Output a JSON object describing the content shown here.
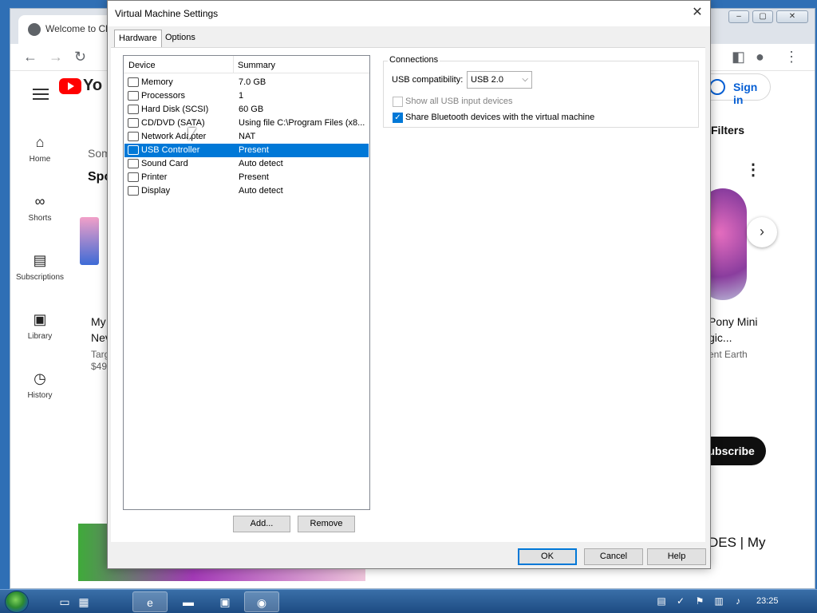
{
  "browser": {
    "tab_title": "Welcome to Cl",
    "window_controls": [
      "–",
      "▢",
      "✕"
    ]
  },
  "youtube": {
    "logo_text": "Yo",
    "sign_in": "Sign in",
    "filters": "Filters",
    "subscribe": "Subscribe",
    "side_items": [
      {
        "label": "Home",
        "icon": "home-icon"
      },
      {
        "label": "Shorts",
        "icon": "shorts-icon"
      },
      {
        "label": "Subscriptions",
        "icon": "subscriptions-icon"
      },
      {
        "label": "Library",
        "icon": "library-icon"
      },
      {
        "label": "History",
        "icon": "history-icon"
      }
    ],
    "fragments": {
      "som": "Som",
      "spo": "Spo",
      "my": "My",
      "nev": "Nev",
      "targ": "Targ",
      "price": "$49",
      "pony_mini": "Pony Mini",
      "gic": "gic...",
      "ent_earth": "ent Earth",
      "des_my": "DES | My"
    }
  },
  "dialog": {
    "title": "Virtual Machine Settings",
    "close_glyph": "✕",
    "tabs": {
      "hardware": "Hardware",
      "options": "Options"
    },
    "list": {
      "col_device": "Device",
      "col_summary": "Summary",
      "rows": [
        {
          "device": "Memory",
          "summary": "7.0 GB"
        },
        {
          "device": "Processors",
          "summary": "1"
        },
        {
          "device": "Hard Disk (SCSI)",
          "summary": "60 GB"
        },
        {
          "device": "CD/DVD (SATA)",
          "summary": "Using file C:\\Program Files (x8..."
        },
        {
          "device": "Network Adapter",
          "summary": "NAT"
        },
        {
          "device": "USB Controller",
          "summary": "Present",
          "selected": true
        },
        {
          "device": "Sound Card",
          "summary": "Auto detect"
        },
        {
          "device": "Printer",
          "summary": "Present"
        },
        {
          "device": "Display",
          "summary": "Auto detect"
        }
      ]
    },
    "add_button": "Add...",
    "remove_button": "Remove",
    "connections": {
      "label": "Connections",
      "usb_compat_label": "USB compatibility:",
      "usb_compat_value": "USB 2.0",
      "show_all_usb": "Show all USB input devices",
      "show_all_usb_checked": false,
      "share_bluetooth": "Share Bluetooth devices with the virtual machine",
      "share_bluetooth_checked": true
    },
    "ok_button": "OK",
    "cancel_button": "Cancel",
    "help_button": "Help"
  },
  "taskbar": {
    "clock": "23:25"
  },
  "colors": {
    "selection": "#0078d7",
    "youtube_red": "#ff0000",
    "link_blue": "#065fd4"
  }
}
